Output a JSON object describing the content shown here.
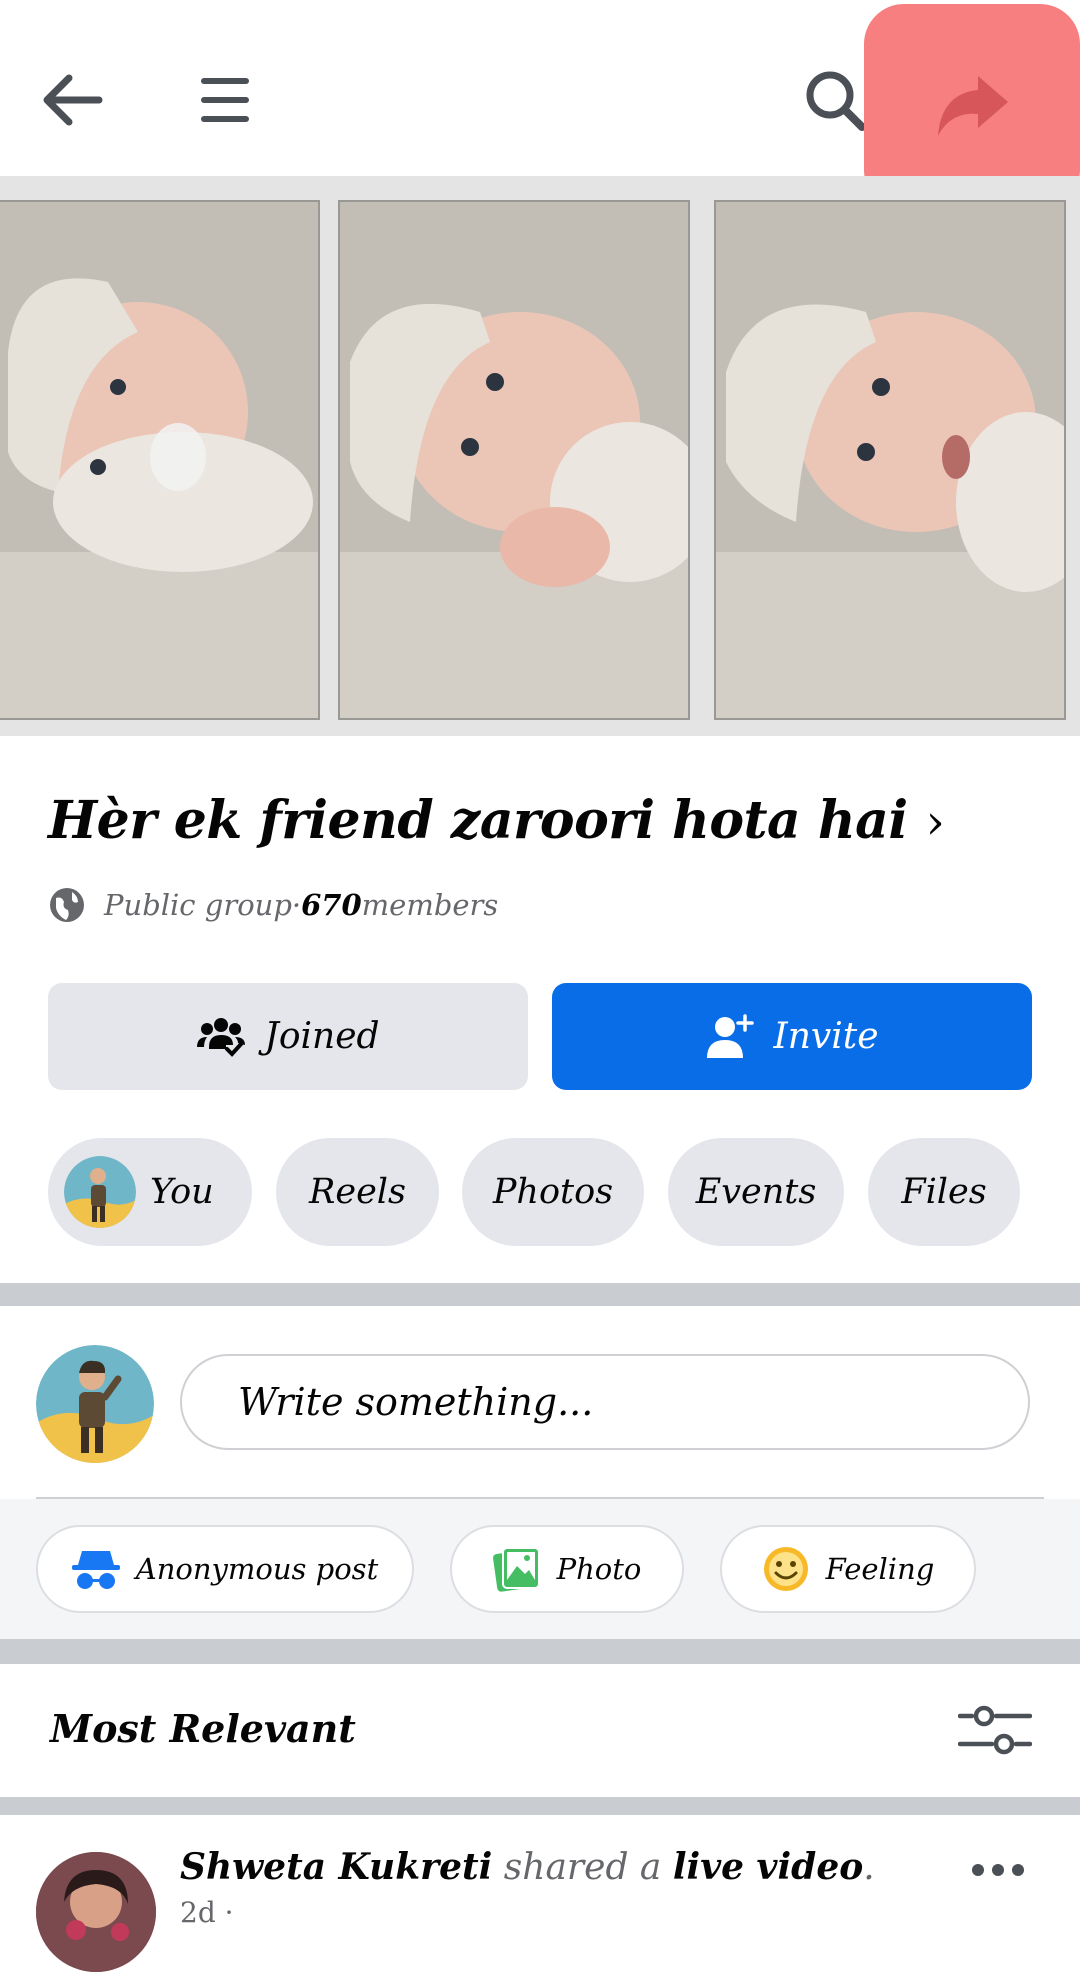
{
  "topbar": {
    "back_icon": "arrow-left-icon",
    "menu_icon": "hamburger-menu-icon",
    "search_icon": "search-icon",
    "share_icon": "share-arrow-icon",
    "share_highlight_color": "#f77f80"
  },
  "group": {
    "title": "Hèr ek friend zaroori hota hai",
    "privacy": "Public group",
    "separator": " · ",
    "member_count": "670",
    "members_label": " members"
  },
  "actions": {
    "joined_label": "Joined",
    "invite_label": "Invite",
    "invite_color": "#0a6de8"
  },
  "chips": {
    "you": "You",
    "reels": "Reels",
    "photos": "Photos",
    "events": "Events",
    "files": "Files"
  },
  "composer": {
    "placeholder": "Write something..."
  },
  "quick_actions": {
    "anonymous": "Anonymous post",
    "photo": "Photo",
    "feeling": "Feeling"
  },
  "feed": {
    "sort_label": "Most Relevant"
  },
  "post": {
    "author": "Shweta Kukreti",
    "action_text": " shared a ",
    "object": "live video",
    "period": ".",
    "time": "2d · "
  }
}
